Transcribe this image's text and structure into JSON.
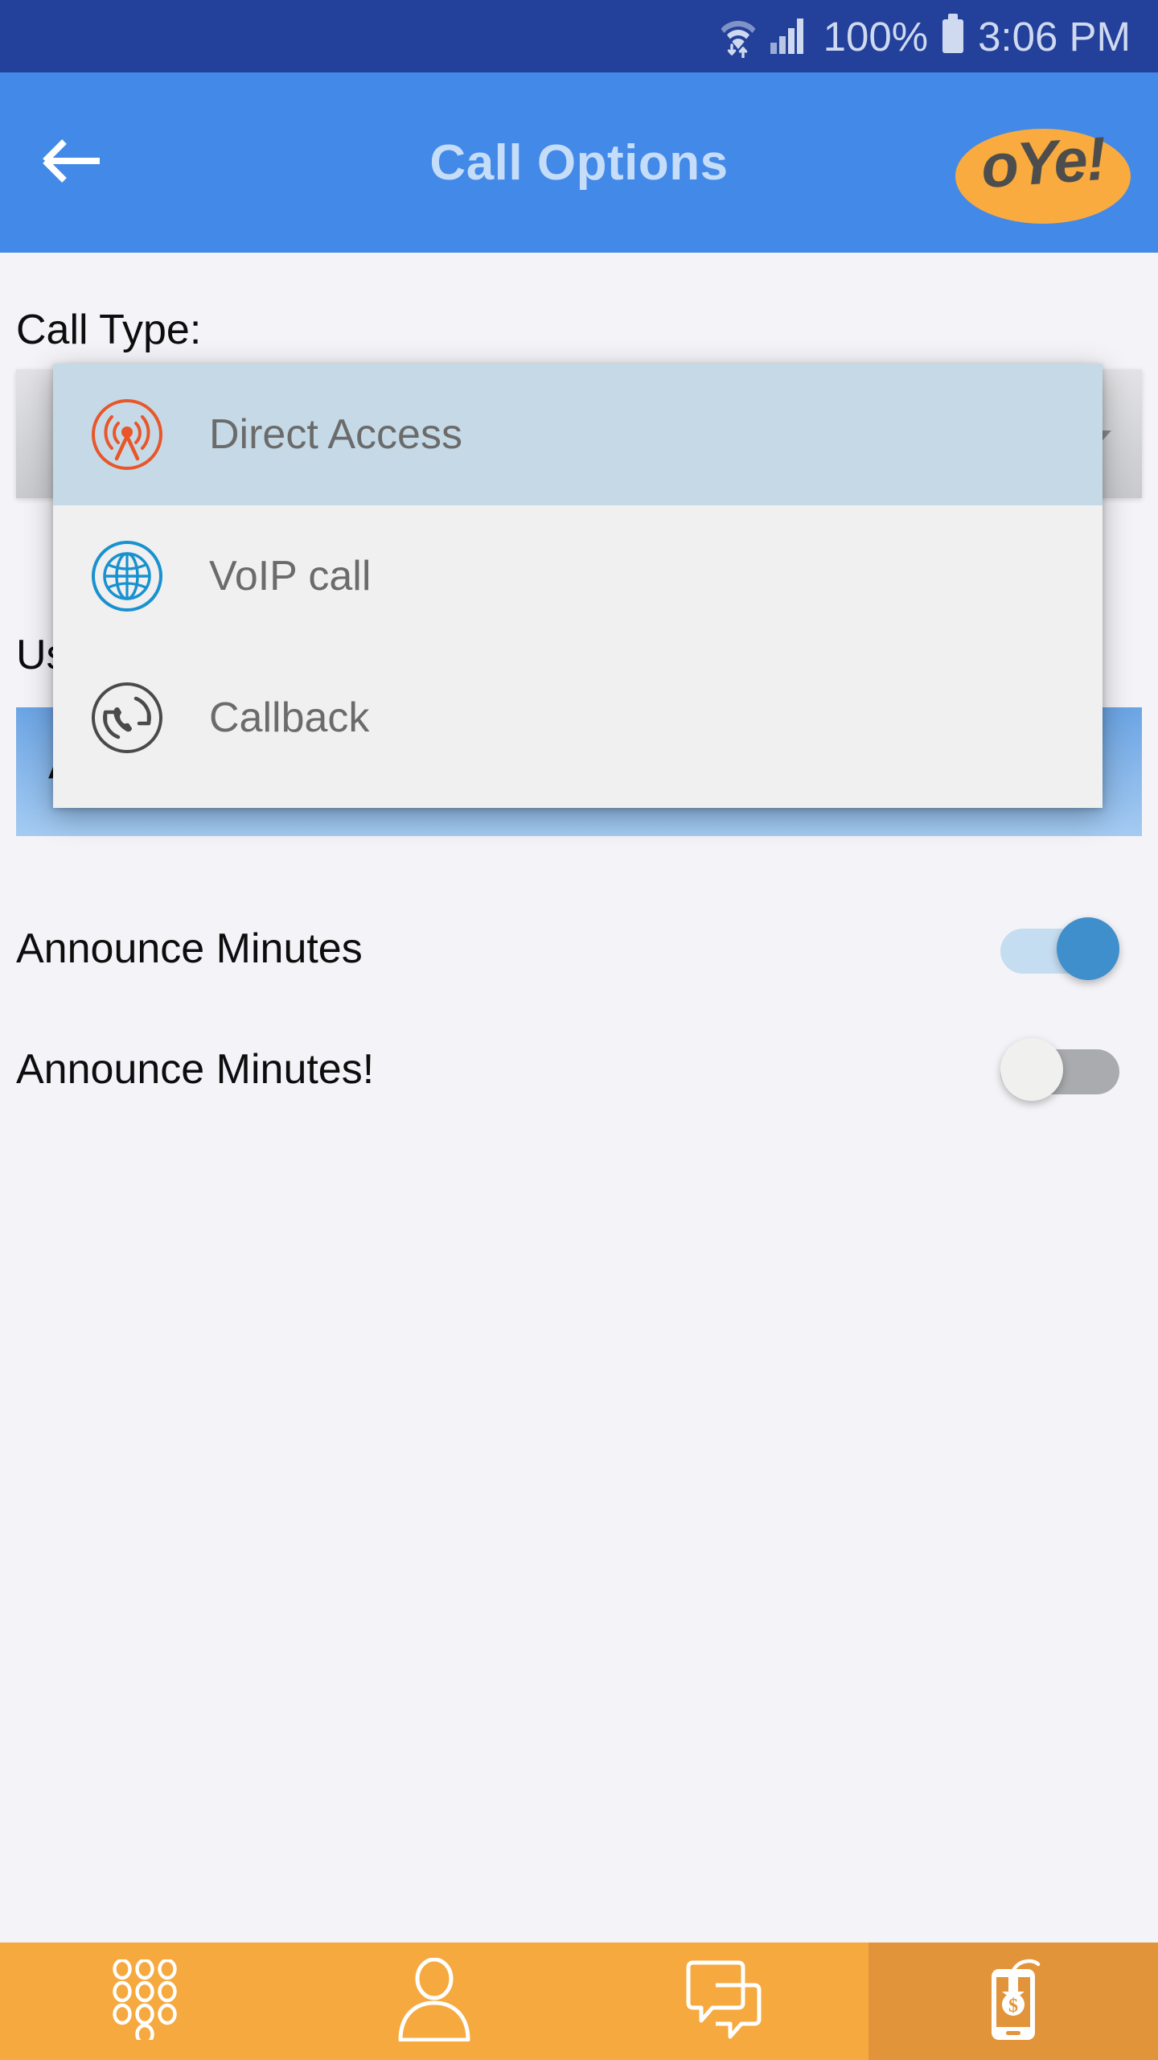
{
  "status_bar": {
    "wifi_icon": "wifi-transfer-icon",
    "signal_icon": "cellular-signal-icon",
    "battery_percent": "100%",
    "battery_icon": "battery-full-icon",
    "time": "3:06 PM",
    "background_color": "#23409a",
    "text_color": "#cfdaf0"
  },
  "app_bar": {
    "back_icon": "back-arrow-icon",
    "title": "Call Options",
    "logo_text": "oYe!",
    "background_color": "#4289e8",
    "title_color": "#c6ddf9",
    "logo_ellipse_color": "#f9ab3f",
    "logo_text_color": "#4d4d4d"
  },
  "main": {
    "call_type_label": "Call Type:",
    "use_label": "Us",
    "announcements_title": "Announcements",
    "toggles": [
      {
        "label": "Announce Minutes",
        "state": "on"
      },
      {
        "label": "Announce Minutes!",
        "state": "off"
      }
    ],
    "toggle_on_track_color": "#c5ddf0",
    "toggle_on_thumb_color": "#3f8fcc",
    "toggle_off_track_color": "#a9abaf",
    "toggle_off_thumb_color": "#f0f0ef"
  },
  "dropdown": {
    "selected_index": 0,
    "selected_bg_color": "#c5dae6",
    "background_color": "#eff0ef",
    "items": [
      {
        "label": "Direct Access",
        "icon": "radio-tower-icon",
        "icon_color": "#e8562a"
      },
      {
        "label": "VoIP call",
        "icon": "globe-icon",
        "icon_color": "#1991d0"
      },
      {
        "label": "Callback",
        "icon": "callback-phone-icon",
        "icon_color": "#4a4a4a"
      }
    ]
  },
  "bottom_nav": {
    "active_index": 3,
    "background_color": "#f5a93f",
    "active_background_color": "#e2943a",
    "tabs": [
      {
        "icon": "dialpad-icon",
        "name": "dialpad"
      },
      {
        "icon": "person-icon",
        "name": "contacts"
      },
      {
        "icon": "chat-bubbles-icon",
        "name": "messages"
      },
      {
        "icon": "phone-topup-icon",
        "name": "top-up"
      }
    ]
  }
}
